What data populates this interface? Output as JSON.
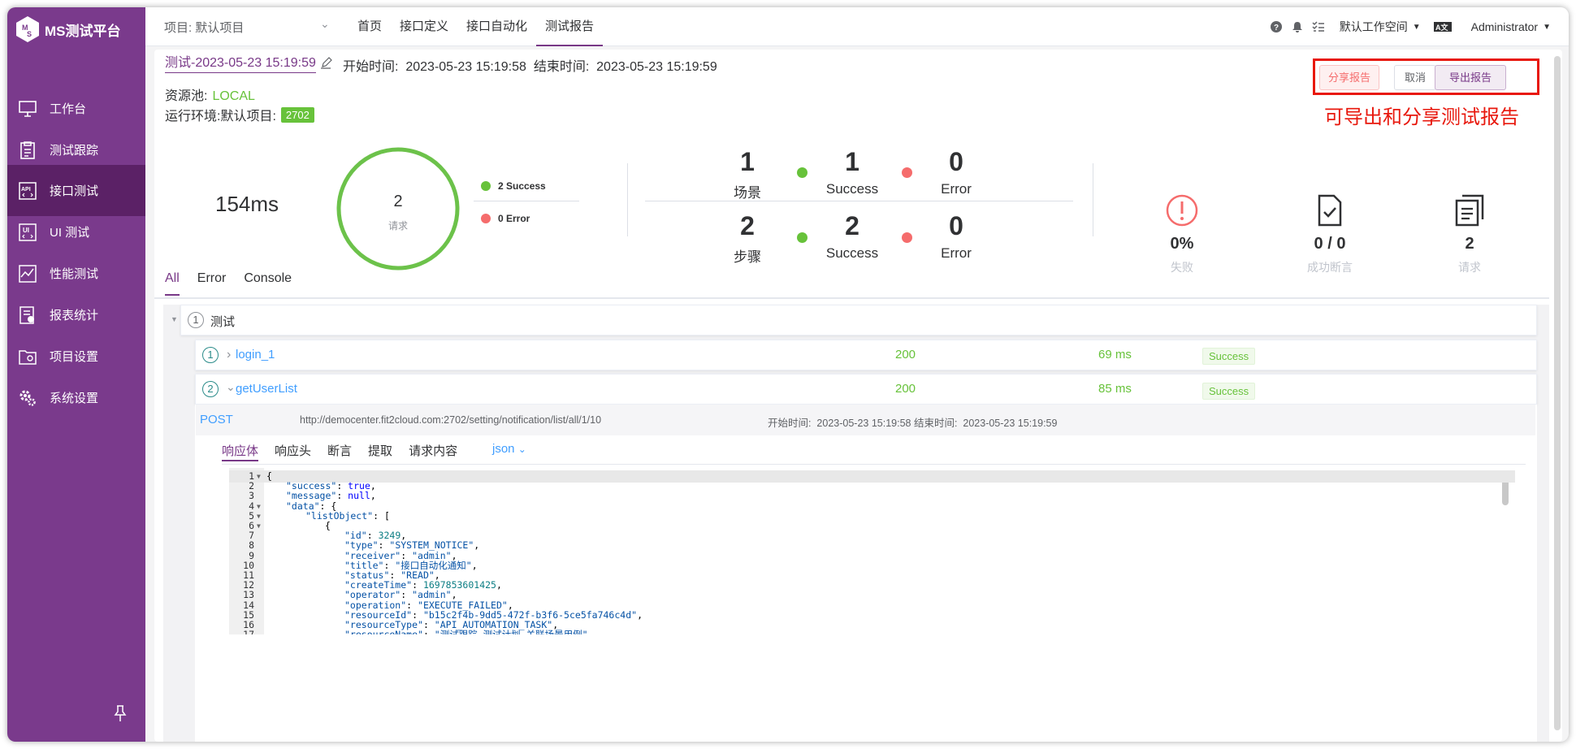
{
  "app": {
    "name": "MS测试平台"
  },
  "sidebar": {
    "items": [
      {
        "label": "工作台",
        "icon": "monitor-icon"
      },
      {
        "label": "测试跟踪",
        "icon": "clipboard-icon"
      },
      {
        "label": "接口测试",
        "icon": "api-icon",
        "active": true
      },
      {
        "label": "UI 测试",
        "icon": "ui-test-icon"
      },
      {
        "label": "性能测试",
        "icon": "performance-chart-icon"
      },
      {
        "label": "报表统计",
        "icon": "report-icon"
      },
      {
        "label": "项目设置",
        "icon": "folder-settings-icon"
      },
      {
        "label": "系统设置",
        "icon": "gears-icon"
      }
    ]
  },
  "header": {
    "project": "项目: 默认项目",
    "nav": [
      {
        "label": "首页"
      },
      {
        "label": "接口定义"
      },
      {
        "label": "接口自动化"
      },
      {
        "label": "测试报告",
        "active": true
      }
    ],
    "workspace": "默认工作空间",
    "user": "Administrator"
  },
  "report": {
    "title": "测试-2023-05-23 15:19:59",
    "start_label": "开始时间:",
    "start_time": "2023-05-23 15:19:58",
    "end_label": "结束时间:",
    "end_time": "2023-05-23 15:19:59",
    "pool_label": "资源池:",
    "pool_value": "LOCAL",
    "env_label": "运行环境:默认项目:",
    "env_tag": "2702",
    "buttons": {
      "share": "分享报告",
      "cancel": "取消",
      "export": "导出报告"
    },
    "annotation": "可导出和分享测试报告"
  },
  "summary": {
    "duration": "154ms",
    "ring_total": "2",
    "ring_label": "请求",
    "legend": {
      "success": "2 Success",
      "error": "0 Error"
    },
    "scenario": {
      "count": "1",
      "label": "场景",
      "success": "1",
      "success_label": "Success",
      "error": "0",
      "error_label": "Error"
    },
    "steps": {
      "count": "2",
      "label": "步骤",
      "success": "2",
      "success_label": "Success",
      "error": "0",
      "error_label": "Error"
    },
    "metrics": [
      {
        "value": "0%",
        "label": "失败",
        "icon": "alert-circle-icon"
      },
      {
        "value": "0 / 0",
        "label": "成功断言",
        "icon": "document-check-icon"
      },
      {
        "value": "2",
        "label": "请求",
        "icon": "documents-copy-icon"
      }
    ]
  },
  "tabs": [
    {
      "label": "All",
      "active": true
    },
    {
      "label": "Error"
    },
    {
      "label": "Console"
    }
  ],
  "tree": {
    "scenario": {
      "num": "1",
      "name": "测试"
    },
    "steps": [
      {
        "num": "1",
        "name": "login_1",
        "code": "200",
        "time": "69 ms",
        "status": "Success",
        "expanded": false
      },
      {
        "num": "2",
        "name": "getUserList",
        "code": "200",
        "time": "85 ms",
        "status": "Success",
        "expanded": true
      }
    ]
  },
  "request": {
    "method": "POST",
    "url": "http://democenter.fit2cloud.com:2702/setting/notification/list/all/1/10",
    "times": "开始时间:  2023-05-23 15:19:58 结束时间:  2023-05-23 15:19:59"
  },
  "response_tabs": [
    {
      "label": "响应体",
      "active": true
    },
    {
      "label": "响应头"
    },
    {
      "label": "断言"
    },
    {
      "label": "提取"
    },
    {
      "label": "请求内容"
    }
  ],
  "format_select": "json",
  "code_lines": [
    {
      "n": "1",
      "fold": true,
      "indent": 0,
      "text": "{"
    },
    {
      "n": "2",
      "indent": 1,
      "key": "\"success\"",
      "val": "true",
      "vt": "b",
      "tail": ","
    },
    {
      "n": "3",
      "indent": 1,
      "key": "\"message\"",
      "val": "null",
      "vt": "b",
      "tail": ","
    },
    {
      "n": "4",
      "fold": true,
      "indent": 1,
      "key": "\"data\"",
      "tail": ": {"
    },
    {
      "n": "5",
      "fold": true,
      "indent": 2,
      "key": "\"listObject\"",
      "tail": ": ["
    },
    {
      "n": "6",
      "fold": true,
      "indent": 3,
      "text": "{"
    },
    {
      "n": "7",
      "indent": 4,
      "key": "\"id\"",
      "val": "3249",
      "vt": "n",
      "tail": ","
    },
    {
      "n": "8",
      "indent": 4,
      "key": "\"type\"",
      "val": "\"SYSTEM_NOTICE\"",
      "vt": "s",
      "tail": ","
    },
    {
      "n": "9",
      "indent": 4,
      "key": "\"receiver\"",
      "val": "\"admin\"",
      "vt": "s",
      "tail": ","
    },
    {
      "n": "10",
      "indent": 4,
      "key": "\"title\"",
      "val": "\"接口自动化通知\"",
      "vt": "s",
      "tail": ","
    },
    {
      "n": "11",
      "indent": 4,
      "key": "\"status\"",
      "val": "\"READ\"",
      "vt": "s",
      "tail": ","
    },
    {
      "n": "12",
      "indent": 4,
      "key": "\"createTime\"",
      "val": "1697853601425",
      "vt": "n",
      "tail": ","
    },
    {
      "n": "13",
      "indent": 4,
      "key": "\"operator\"",
      "val": "\"admin\"",
      "vt": "s",
      "tail": ","
    },
    {
      "n": "14",
      "indent": 4,
      "key": "\"operation\"",
      "val": "\"EXECUTE_FAILED\"",
      "vt": "s",
      "tail": ","
    },
    {
      "n": "15",
      "indent": 4,
      "key": "\"resourceId\"",
      "val": "\"b15c2f4b-9dd5-472f-b3f6-5ce5fa746c4d\"",
      "vt": "s",
      "tail": ","
    },
    {
      "n": "16",
      "indent": 4,
      "key": "\"resourceType\"",
      "val": "\"API_AUTOMATION_TASK\"",
      "vt": "s",
      "tail": ","
    },
    {
      "n": "17",
      "indent": 4,
      "key": "\"resourceName\"",
      "val": "\"测试跟踪-测试计划-关联场景用例\"",
      "vt": "s",
      "tail": ","
    }
  ],
  "colors": {
    "sidebar": "#7a3a8c",
    "sidebar_active": "#5b2166",
    "accent": "#783887",
    "success": "#67c23a",
    "error": "#f56c6c",
    "annotation": "#e8180d"
  }
}
